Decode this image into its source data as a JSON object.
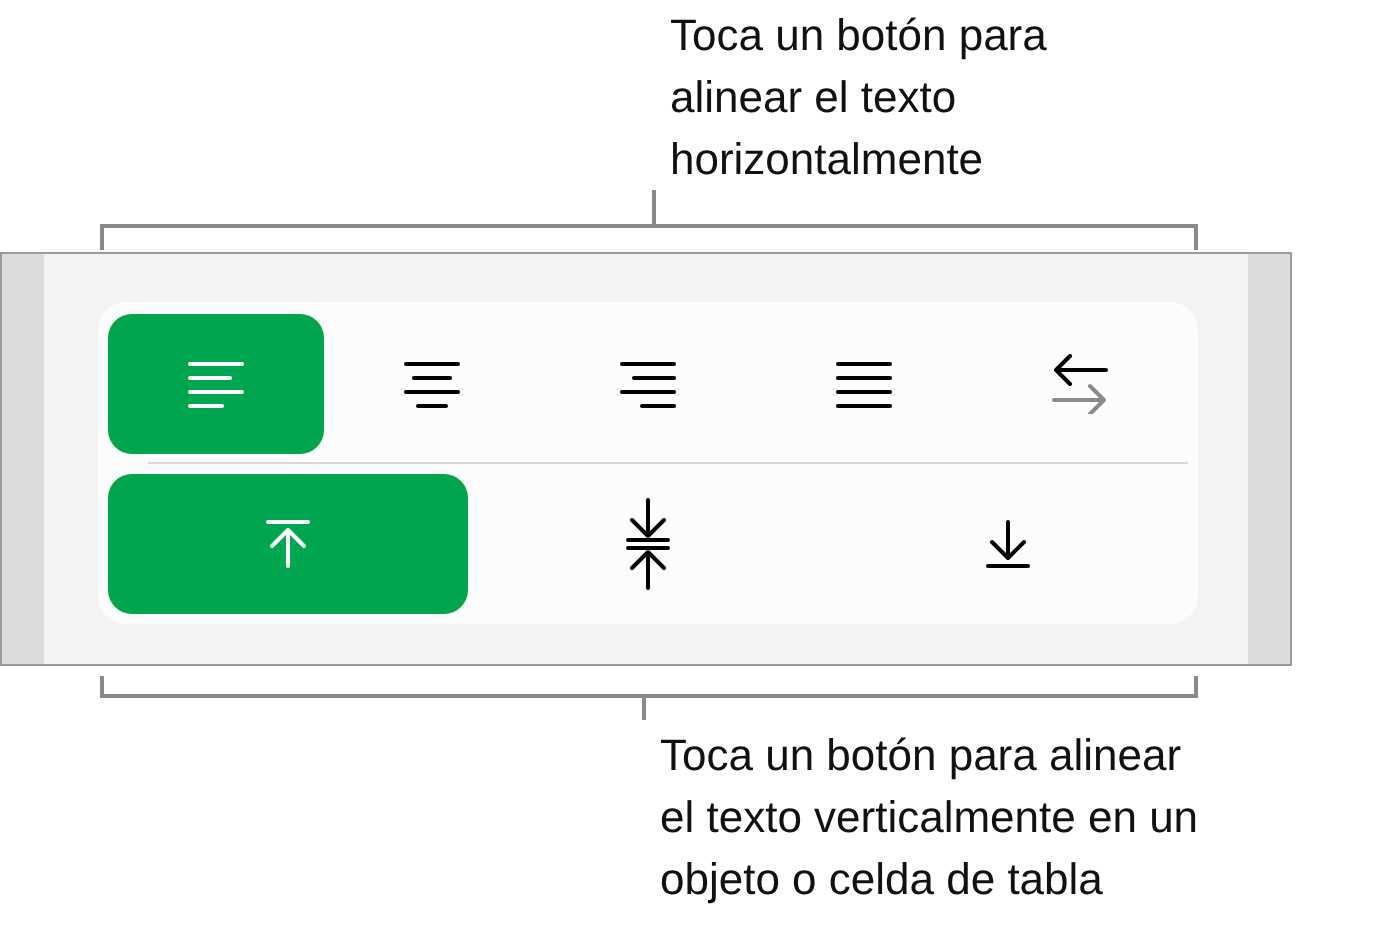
{
  "top_callout": "Toca un botón para\nalinear el texto\nhorizontalmente",
  "horizontal_buttons": [
    {
      "kind": "left",
      "selected": true
    },
    {
      "kind": "center",
      "selected": false
    },
    {
      "kind": "right",
      "selected": false
    },
    {
      "kind": "justify",
      "selected": false
    },
    {
      "kind": "direction",
      "selected": false
    }
  ],
  "vertical_buttons": [
    {
      "kind": "top",
      "selected": true
    },
    {
      "kind": "middle",
      "selected": false
    },
    {
      "kind": "bottom",
      "selected": false
    }
  ],
  "bottom_callout": "Toca un botón para alinear\nel texto verticalmente en un\nobjeto o celda de tabla"
}
